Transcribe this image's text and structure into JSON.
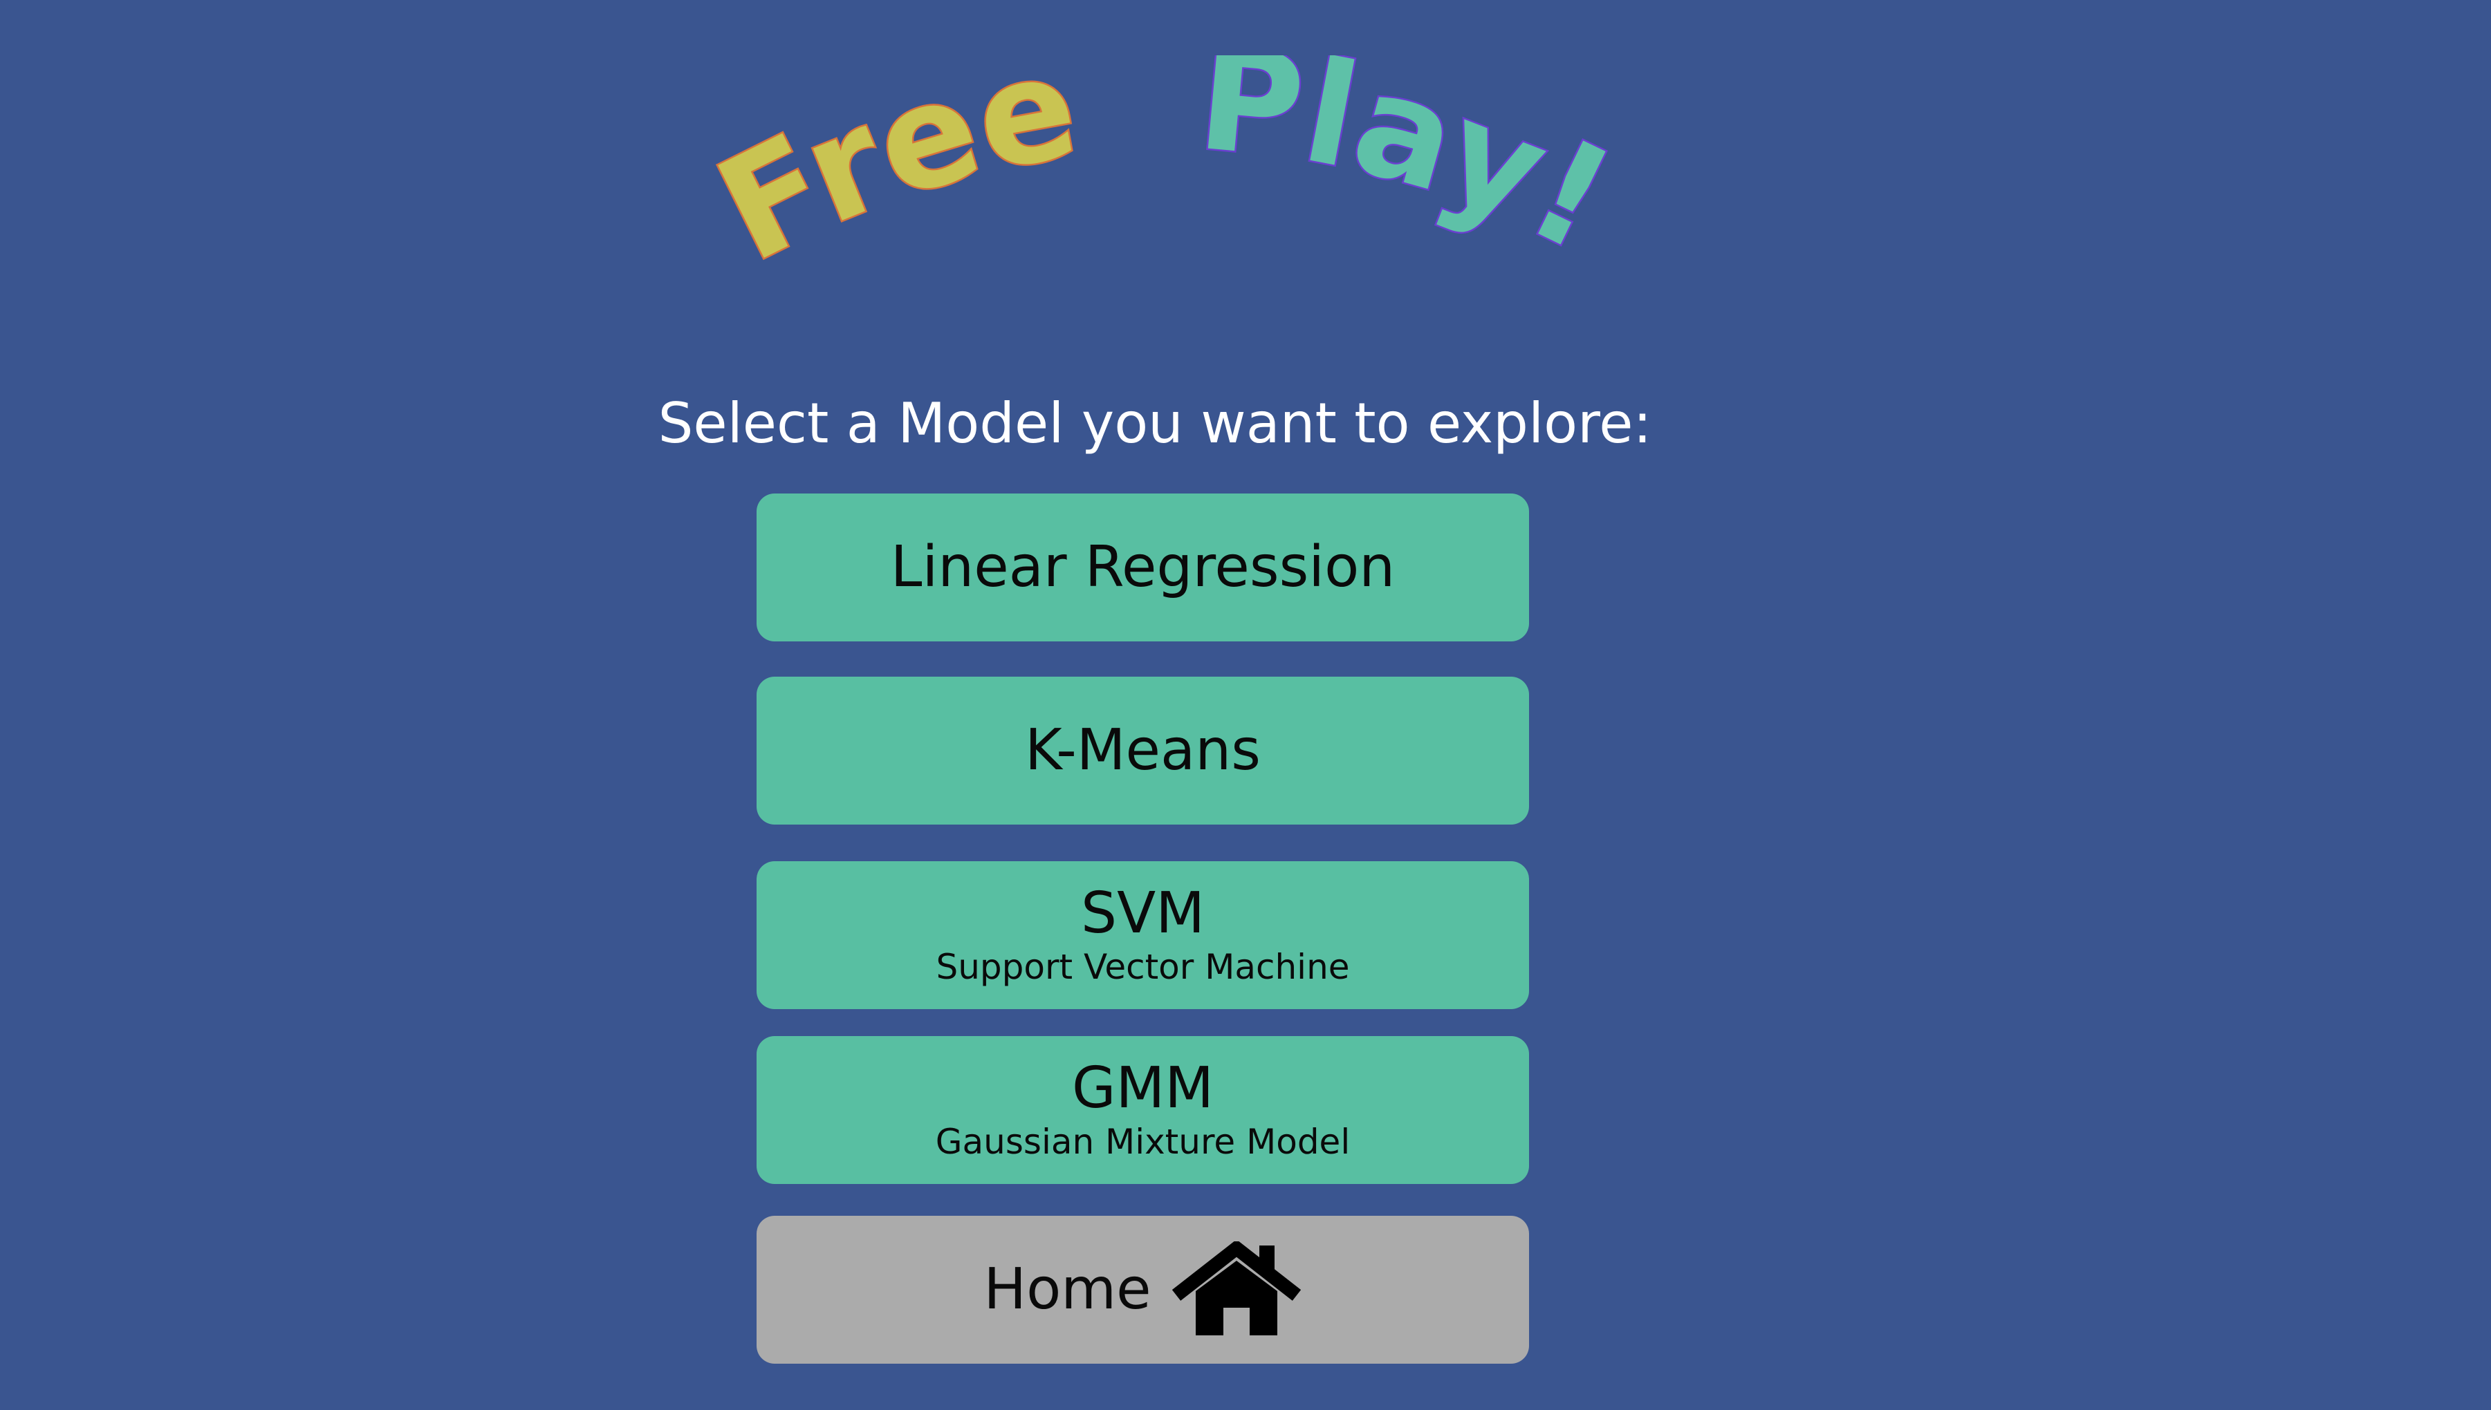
{
  "title": {
    "word1": "Free",
    "word2": "Play!"
  },
  "prompt": "Select a Model you want to explore:",
  "buttons": {
    "linear_regression": {
      "label": "Linear Regression"
    },
    "kmeans": {
      "label": "K-Means"
    },
    "svm": {
      "label": "SVM",
      "sublabel": "Support Vector Machine"
    },
    "gmm": {
      "label": "GMM",
      "sublabel": "Gaussian Mixture Model"
    },
    "home": {
      "label": "Home",
      "icon": "home-icon"
    }
  },
  "colors": {
    "background": "#3a5590",
    "model_button": "#58bfa2",
    "home_button": "#ababab",
    "title_free_fill": "#c9c452",
    "title_free_outline": "#d8733a",
    "title_play_fill": "#5ec1a8",
    "title_play_outline": "#6a3fd0"
  }
}
